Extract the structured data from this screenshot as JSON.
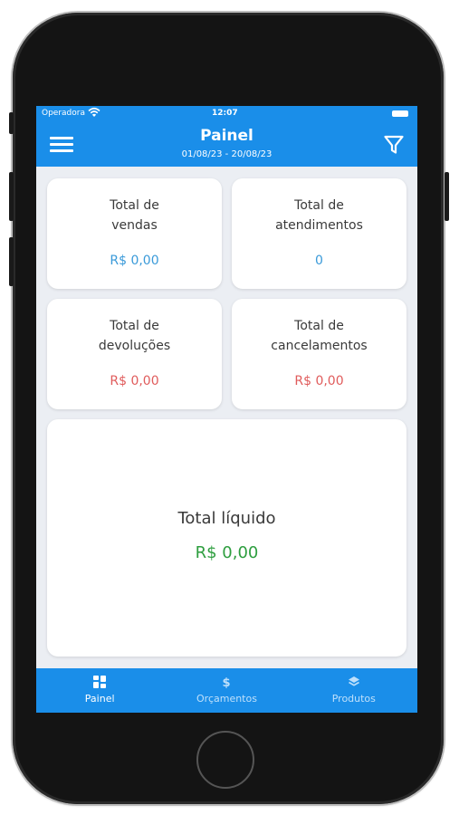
{
  "status_bar": {
    "carrier": "Operadora",
    "time": "12:07"
  },
  "header": {
    "title": "Painel",
    "date_range": "01/08/23 - 20/08/23"
  },
  "cards": [
    {
      "label": "Total de\nvendas",
      "value": "R$ 0,00",
      "value_color": "#3a9ad9"
    },
    {
      "label": "Total de\natendimentos",
      "value": "0",
      "value_color": "#3a9ad9"
    },
    {
      "label": "Total de\ndevoluções",
      "value": "R$ 0,00",
      "value_color": "#e05c5c"
    },
    {
      "label": "Total de\ncancelamentos",
      "value": "R$ 0,00",
      "value_color": "#e05c5c"
    }
  ],
  "total": {
    "label": "Total líquido",
    "value": "R$ 0,00",
    "value_color": "#2e9e3f"
  },
  "tabs": [
    {
      "label": "Painel",
      "icon": "dashboard-icon",
      "active": true
    },
    {
      "label": "Orçamentos",
      "icon": "dollar-icon",
      "active": false
    },
    {
      "label": "Produtos",
      "icon": "layers-icon",
      "active": false
    }
  ],
  "colors": {
    "accent": "#1a8ee9",
    "background": "#ebeef3"
  }
}
